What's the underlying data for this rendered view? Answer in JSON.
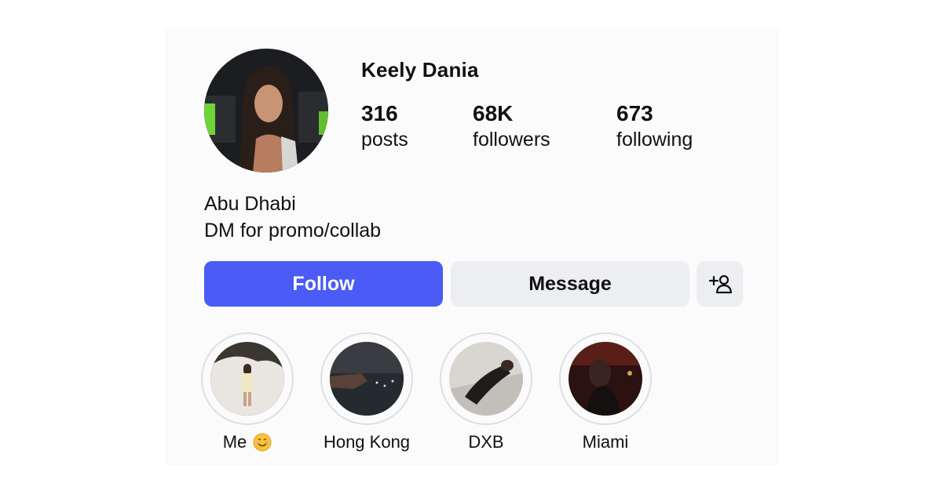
{
  "profile": {
    "name": "Keely Dania",
    "bio_lines": [
      "Abu Dhabi",
      "DM for promo/collab"
    ]
  },
  "stats": [
    {
      "value": "316",
      "label": "posts"
    },
    {
      "value": "68K",
      "label": "followers"
    },
    {
      "value": "673",
      "label": "following"
    }
  ],
  "actions": {
    "follow_label": "Follow",
    "message_label": "Message",
    "add_user_icon": "person-add-icon"
  },
  "highlights": [
    {
      "label": "Me",
      "emoji_icon": "smiling-face-emoji"
    },
    {
      "label": "Hong Kong"
    },
    {
      "label": "DXB"
    },
    {
      "label": "Miami"
    }
  ],
  "colors": {
    "follow_button": "#4a5bf6",
    "secondary_button": "#eceef1",
    "highlight_ring": "#dcdfe4"
  }
}
